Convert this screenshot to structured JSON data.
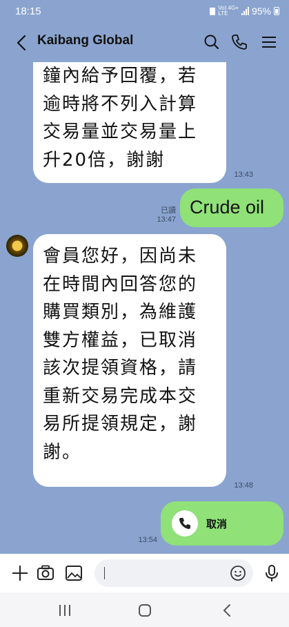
{
  "status_bar": {
    "time": "18:15",
    "network_top": "Vo) 4G+",
    "network_bottom": "LTE",
    "battery": "95%"
  },
  "header": {
    "title": "Kaibang Global"
  },
  "messages": {
    "m1": {
      "text": "鐘內給予回覆，若\n逾時將不列入計算\n交易量並交易量上\n升20倍，謝謝",
      "time": "13:43"
    },
    "m2": {
      "text": "Crude oil",
      "read": "已讀",
      "time": "13:47"
    },
    "m3": {
      "text": "會員您好，因尚未\n在時間內回答您的\n購買類別，為維護\n雙方權益，已取消\n該次提領資格，請\n重新交易完成本交\n易所提領規定，謝\n謝。",
      "time": "13:48"
    },
    "m4": {
      "label": "取消",
      "time": "13:54"
    }
  },
  "colors": {
    "chat_bg": "#8aa4cf",
    "incoming": "#ffffff",
    "outgoing": "#8fe178"
  },
  "icons": [
    "back-icon",
    "search-icon",
    "phone-icon",
    "menu-icon",
    "plus-icon",
    "camera-icon",
    "image-icon",
    "emoji-icon",
    "mic-icon",
    "recent-apps-icon",
    "home-icon",
    "nav-back-icon"
  ]
}
